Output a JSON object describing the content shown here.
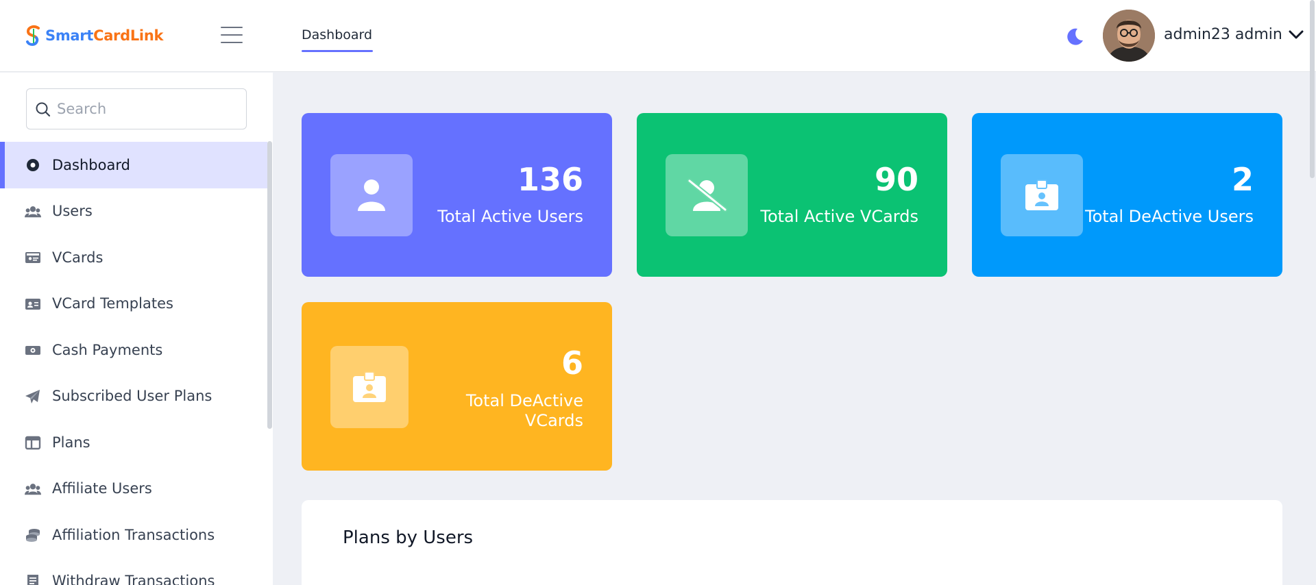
{
  "brand": {
    "name_part1": "Smart",
    "name_part2": "CardLink"
  },
  "header": {
    "tab": "Dashboard",
    "username": "admin23 admin"
  },
  "search": {
    "placeholder": "Search"
  },
  "sidebar": {
    "items": [
      {
        "label": "Dashboard",
        "icon": "dashboard-icon",
        "active": true
      },
      {
        "label": "Users",
        "icon": "users-icon"
      },
      {
        "label": "VCards",
        "icon": "vcard-icon"
      },
      {
        "label": "VCard Templates",
        "icon": "vcard-template-icon"
      },
      {
        "label": "Cash Payments",
        "icon": "money-icon"
      },
      {
        "label": "Subscribed User Plans",
        "icon": "paper-plane-icon"
      },
      {
        "label": "Plans",
        "icon": "plans-icon"
      },
      {
        "label": "Affiliate Users",
        "icon": "users-icon"
      },
      {
        "label": "Affiliation Transactions",
        "icon": "coins-icon"
      },
      {
        "label": "Withdraw Transactions",
        "icon": "receipt-icon"
      }
    ]
  },
  "stats": [
    {
      "value": "136",
      "label": "Total Active Users",
      "color": "#6571ff",
      "icon": "user-icon"
    },
    {
      "value": "90",
      "label": "Total Active VCards",
      "color": "#0bc273",
      "icon": "user-slash-icon"
    },
    {
      "value": "2",
      "label": "Total DeActive Users",
      "color": "#0099fb",
      "icon": "id-badge-icon"
    },
    {
      "value": "6",
      "label": "Total DeActive VCards",
      "color": "#ffb521",
      "icon": "id-badge-icon"
    }
  ],
  "panel": {
    "title": "Plans by Users"
  }
}
